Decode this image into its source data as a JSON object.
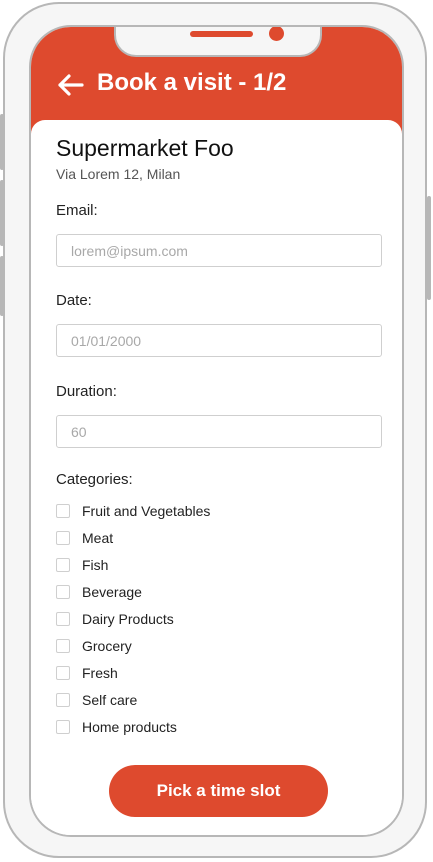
{
  "header": {
    "title": "Book a visit - 1/2",
    "back_icon": "arrow-left-icon",
    "accent_color": "#de4a2e"
  },
  "store": {
    "name": "Supermarket Foo",
    "address": "Via Lorem 12, Milan"
  },
  "form": {
    "email": {
      "label": "Email:",
      "placeholder": "lorem@ipsum.com",
      "value": ""
    },
    "date": {
      "label": "Date:",
      "placeholder": "01/01/2000",
      "value": ""
    },
    "duration": {
      "label": "Duration:",
      "placeholder": "60",
      "value": ""
    },
    "categories": {
      "label": "Categories:",
      "items": [
        {
          "label": "Fruit and Vegetables",
          "checked": false
        },
        {
          "label": "Meat",
          "checked": false
        },
        {
          "label": "Fish",
          "checked": false
        },
        {
          "label": "Beverage",
          "checked": false
        },
        {
          "label": "Dairy Products",
          "checked": false
        },
        {
          "label": "Grocery",
          "checked": false
        },
        {
          "label": "Fresh",
          "checked": false
        },
        {
          "label": "Self care",
          "checked": false
        },
        {
          "label": "Home products",
          "checked": false
        }
      ]
    }
  },
  "actions": {
    "submit_label": "Pick a time slot"
  }
}
